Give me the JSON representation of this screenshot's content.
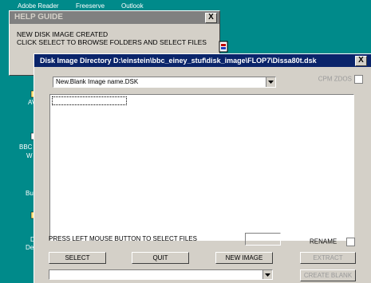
{
  "desktop": {
    "top_labels": [
      "Adobe Reader",
      "Freeserve",
      "Outlook"
    ],
    "icon_labels": [
      "AV",
      "BBC",
      "W",
      "Bu",
      "D",
      "De"
    ]
  },
  "help_window": {
    "title": "HELP GUIDE",
    "close_label": "X",
    "line1": "NEW DISK IMAGE CREATED",
    "line2": "CLICK SELECT TO BROWSE FOLDERS AND SELECT FILES"
  },
  "dialog": {
    "title": "Disk Image Directory D:\\einstein\\bbc_einey_stuf\\disk_image\\FLOP7\\Dissa80t.dsk",
    "close_label": "X",
    "image_combo_value": "New.Blank Image name.DSK",
    "cpm_label": "CPM ZDOS",
    "status_text": "PRESS LEFT MOUSE BUTTON TO SELECT FILES",
    "rename_label": "RENAME",
    "buttons": {
      "select": "SELECT",
      "quit": "QUIT",
      "new_image": "NEW IMAGE",
      "extract": "EXTRACT",
      "create_blank": "CREATE BLANK"
    },
    "bottom_combo_value": ""
  },
  "colors": {
    "desktop": "#008a8a",
    "active_title": "#0a246a",
    "inactive_title": "#808080"
  }
}
